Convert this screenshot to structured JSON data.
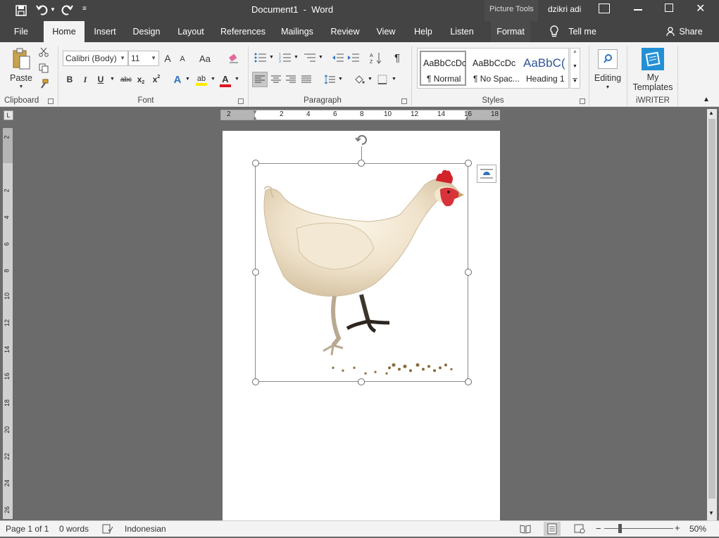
{
  "titlebar": {
    "title": "Document1  -  Word",
    "context": "Picture Tools",
    "user": "dzikri adi"
  },
  "tabs": [
    "File",
    "Home",
    "Insert",
    "Design",
    "Layout",
    "References",
    "Mailings",
    "Review",
    "View",
    "Help",
    "Listen",
    "Format"
  ],
  "tell_me": "Tell me",
  "share": "Share",
  "clipboard": {
    "paste": "Paste",
    "label": "Clipboard"
  },
  "font": {
    "name": "Calibri (Body)",
    "size": "11",
    "label": "Font",
    "grow": "A",
    "shrink": "A",
    "case": "Aa",
    "bold": "B",
    "italic": "I",
    "underline": "U",
    "strike": "abc",
    "sub": "x",
    "sup": "x",
    "effects": "A",
    "color": "A"
  },
  "paragraph": {
    "label": "Paragraph",
    "pilcrow": "¶"
  },
  "styles": {
    "label": "Styles",
    "items": [
      {
        "sample": "AaBbCcDc",
        "name": "¶ Normal"
      },
      {
        "sample": "AaBbCcDc",
        "name": "¶ No Spac..."
      },
      {
        "sample": "AaBbC(",
        "name": "Heading 1"
      }
    ]
  },
  "editing": {
    "label": "Editing"
  },
  "iwriter": {
    "line1": "My",
    "line2": "Templates",
    "label": "iWRITER"
  },
  "ruler": {
    "h_ticks": [
      "2",
      "2",
      "4",
      "6",
      "8",
      "10",
      "12",
      "14",
      "16",
      "18"
    ],
    "v_ticks": [
      "2",
      "2",
      "4",
      "6",
      "8",
      "10",
      "12",
      "14",
      "16",
      "18",
      "20",
      "22",
      "24",
      "26"
    ]
  },
  "statusbar": {
    "page": "Page 1 of 1",
    "words": "0 words",
    "language": "Indonesian",
    "zoom": "50%"
  },
  "zoom_level": 0.5
}
